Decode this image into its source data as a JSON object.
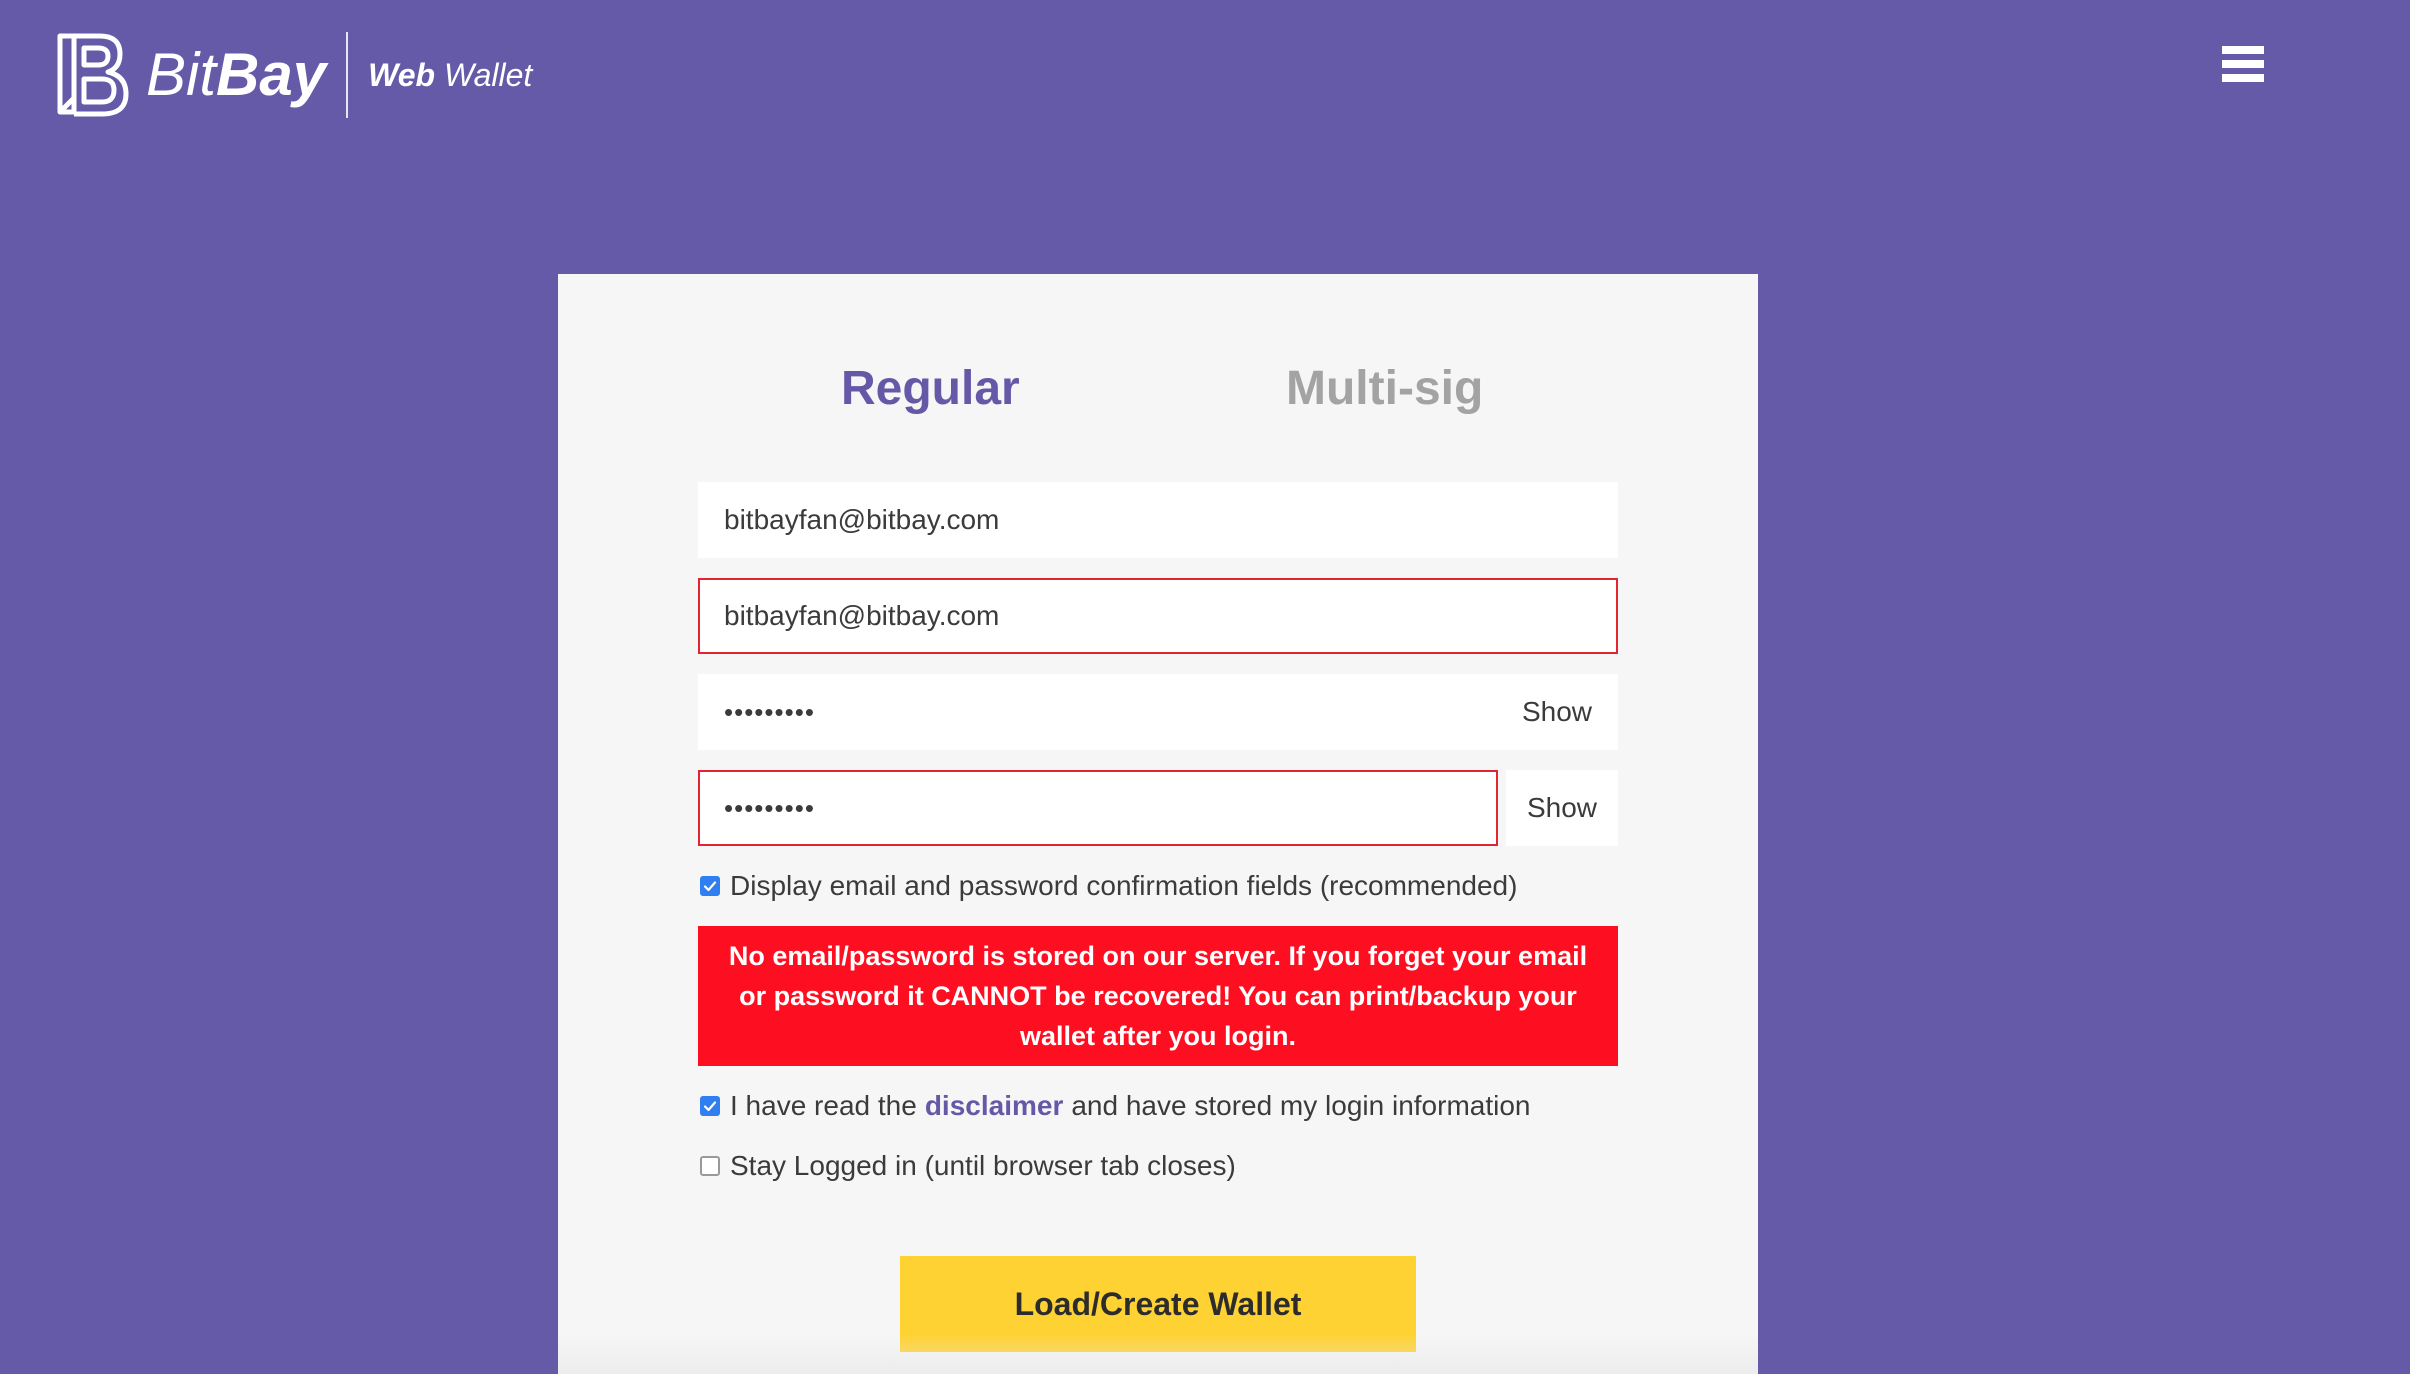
{
  "header": {
    "brand_bit": "Bit",
    "brand_bay": "Bay",
    "sub_web": "Web",
    "sub_wallet": " Wallet",
    "logo_icon": "bitbay-logo-icon",
    "menu_icon": "hamburger-menu-icon"
  },
  "tabs": [
    {
      "label": "Regular",
      "active": true
    },
    {
      "label": "Multi-sig",
      "active": false
    }
  ],
  "form": {
    "email_value": "bitbayfan@bitbay.com",
    "email_confirm_value": "bitbayfan@bitbay.com",
    "password_value": "•••••••••",
    "password_confirm_value": "•••••••••",
    "show_label": "Show",
    "confirm_fields_label": "Display email and password confirmation fields (recommended)",
    "confirm_fields_checked": true,
    "warning_text": "No email/password is stored on our server. If you forget your email or password it CANNOT be recovered! You can print/backup your wallet after you login.",
    "disclaimer_prefix": "I have read the",
    "disclaimer_link": "disclaimer",
    "disclaimer_suffix": "and have stored my login information",
    "disclaimer_checked": true,
    "stay_logged_label": "Stay Logged in (until browser tab closes)",
    "stay_logged_checked": false,
    "submit_label": "Load/Create Wallet"
  },
  "colors": {
    "background": "#655aa8",
    "accent": "#6559a7",
    "warning": "#fd0e20",
    "button": "#ffd233",
    "error_border": "#e3252f",
    "checkbox": "#2f7ff0"
  }
}
